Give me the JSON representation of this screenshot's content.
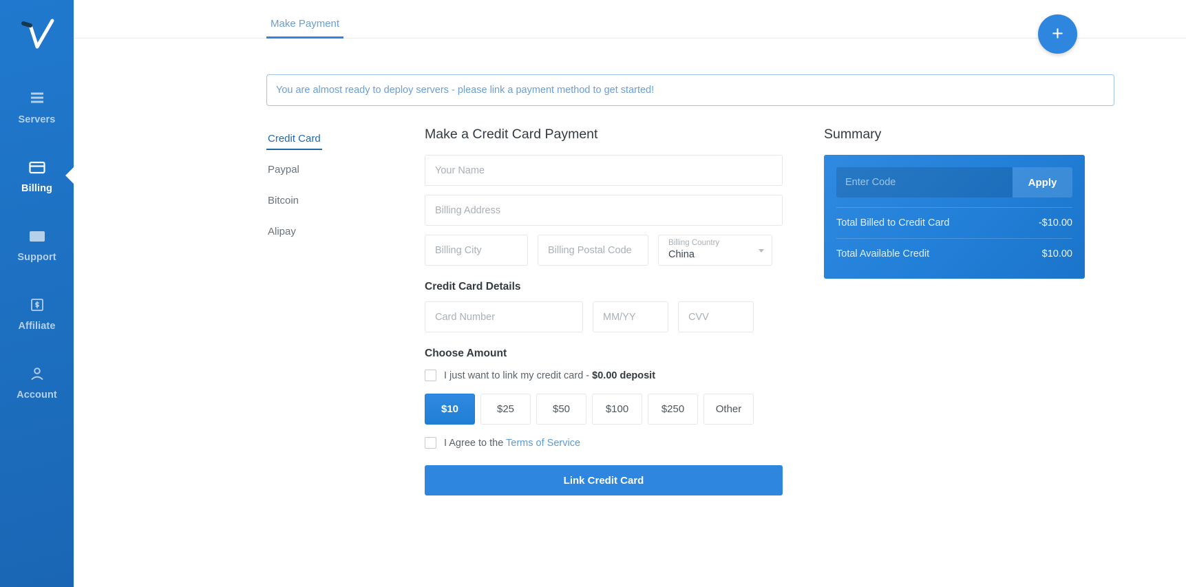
{
  "brand": {
    "accent": "#2e86de",
    "sidebar_bg": "#1d6fc0",
    "logo_icon": "checkmark-logo"
  },
  "sidebar": {
    "items": [
      {
        "label": "Servers",
        "icon": "server-stack-icon",
        "active": false
      },
      {
        "label": "Billing",
        "icon": "credit-card-icon",
        "active": true
      },
      {
        "label": "Support",
        "icon": "envelope-icon",
        "active": false
      },
      {
        "label": "Affiliate",
        "icon": "dollar-box-icon",
        "active": false
      },
      {
        "label": "Account",
        "icon": "user-icon",
        "active": false
      }
    ]
  },
  "topbar": {
    "tabs": [
      {
        "label": "Make Payment",
        "active": true
      }
    ],
    "add_button": {
      "icon": "plus-icon",
      "label": "+"
    }
  },
  "banner": {
    "text": "You are almost ready to deploy servers - please link a payment method to get started!"
  },
  "methods": [
    {
      "label": "Credit Card",
      "active": true
    },
    {
      "label": "Paypal",
      "active": false
    },
    {
      "label": "Bitcoin",
      "active": false
    },
    {
      "label": "Alipay",
      "active": false
    }
  ],
  "form": {
    "title": "Make a Credit Card Payment",
    "name_placeholder": "Your Name",
    "name_value": "",
    "address_placeholder": "Billing Address",
    "address_value": "",
    "city_placeholder": "Billing City",
    "city_value": "",
    "postal_placeholder": "Billing Postal Code",
    "postal_value": "",
    "country_label": "Billing Country",
    "country_value": "China",
    "card_section_title": "Credit Card Details",
    "card_number_placeholder": "Card Number",
    "card_number_value": "",
    "expiry_placeholder": "MM/YY",
    "expiry_value": "",
    "cvv_placeholder": "CVV",
    "cvv_value": "",
    "amount_section_title": "Choose Amount",
    "link_only_text": "I just want to link my credit card - ",
    "link_only_amount": "$0.00 deposit",
    "link_only_checked": false,
    "amounts": [
      {
        "label": "$10",
        "selected": true
      },
      {
        "label": "$25",
        "selected": false
      },
      {
        "label": "$50",
        "selected": false
      },
      {
        "label": "$100",
        "selected": false
      },
      {
        "label": "$250",
        "selected": false
      },
      {
        "label": "Other",
        "selected": false
      }
    ],
    "tos_text": "I Agree to the ",
    "tos_link": "Terms of Service",
    "tos_checked": false,
    "submit_label": "Link Credit Card"
  },
  "summary": {
    "title": "Summary",
    "code_placeholder": "Enter Code",
    "code_value": "",
    "apply_label": "Apply",
    "lines": [
      {
        "label": "Total Billed to Credit Card",
        "value": "-$10.00"
      },
      {
        "label": "Total Available Credit",
        "value": "$10.00"
      }
    ]
  }
}
